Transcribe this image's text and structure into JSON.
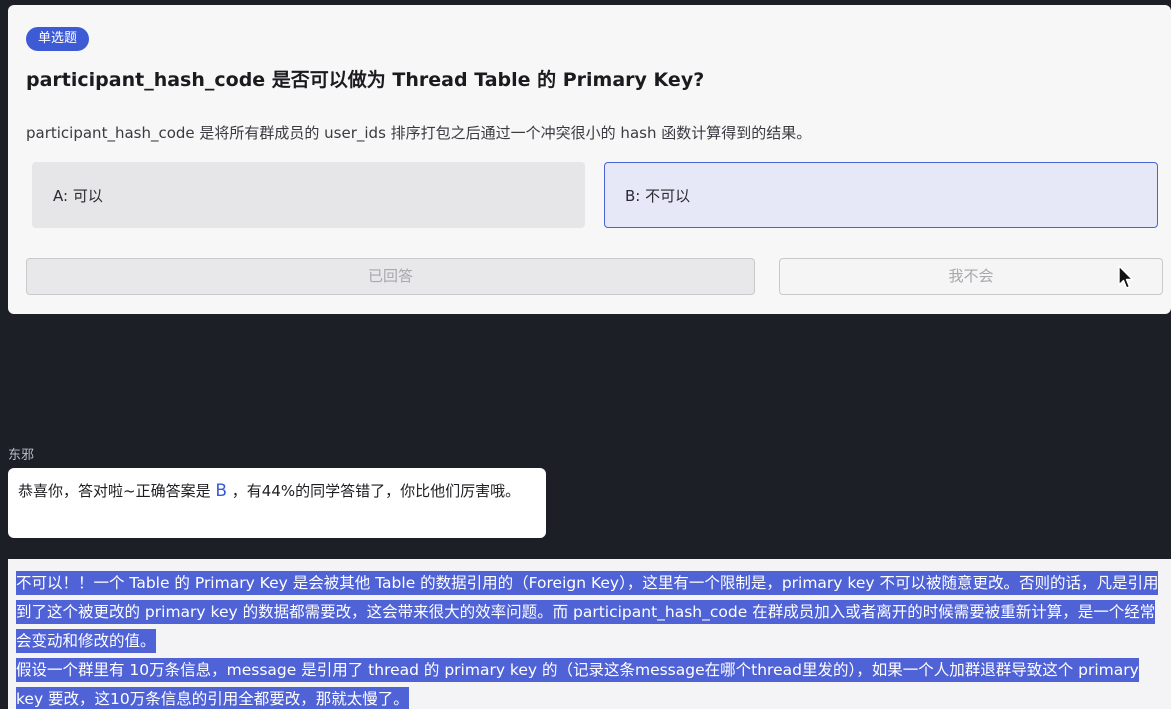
{
  "quiz": {
    "type_badge": "单选题",
    "title": "participant_hash_code 是否可以做为 Thread Table 的 Primary Key?",
    "description": "participant_hash_code 是将所有群成员的 user_ids 排序打包之后通过一个冲突很小的 hash 函数计算得到的结果。",
    "options": [
      {
        "label": "A:  可以",
        "selected": false
      },
      {
        "label": "B:  不可以",
        "selected": true
      }
    ],
    "answered_button": "已回答",
    "dont_know_button": "我不会"
  },
  "chat": {
    "sender": "东邪",
    "message_prefix": "恭喜你，答对啦~正确答案是 ",
    "answer_letter": "B",
    "message_suffix": " ，有44%的同学答错了，你比他们厉害哦。"
  },
  "explanation": {
    "paragraph1": "不可以！！一个 Table 的 Primary Key 是会被其他 Table 的数据引用的（Foreign Key），这里有一个限制是，primary key 不可以被随意更改。否则的话，凡是引用到了这个被更改的 primary key 的数据都需要改，这会带来很大的效率问题。而 participant_hash_code 在群成员加入或者离开的时候需要被重新计算，是一个经常会变动和修改的值。",
    "paragraph2": "假设一个群里有 10万条信息，message 是引用了 thread 的 primary key 的（记录这条message在哪个thread里发的），如果一个人加群退群导致这个 primary key 要改，这10万条信息的引用全都要改，那就太慢了。"
  },
  "colors": {
    "accent": "#3e5bd6",
    "selected_option_bg": "#e6e8f8",
    "highlight": "#4f62d6",
    "dark_bg": "#1c1f26"
  },
  "icons": [
    "mouse-pointer-icon"
  ]
}
